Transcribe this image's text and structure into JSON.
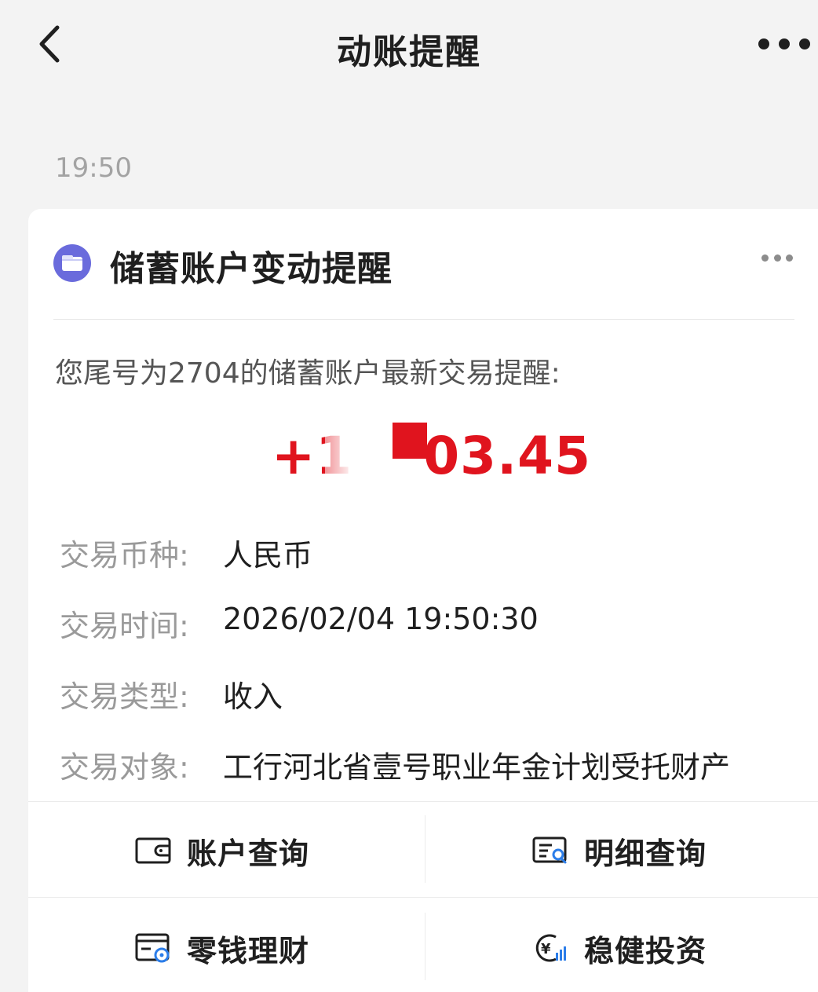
{
  "header": {
    "title": "动账提醒",
    "back_icon": "chevron-left-icon",
    "more_icon": "more-horizontal-icon"
  },
  "message": {
    "time": "19:50"
  },
  "card": {
    "icon": "wallet-icon",
    "icon_color": "#6a6bdc",
    "title": "储蓄账户变动提醒",
    "more_icon": "more-horizontal-icon",
    "intro": "您尾号为2704的储蓄账户最新交易提醒:",
    "amount": {
      "visible_prefix": "+1",
      "visible_suffix": "03.45",
      "color": "#e0141e"
    },
    "details": [
      {
        "label": "交易币种:",
        "value": "人民币"
      },
      {
        "label": "交易时间:",
        "value": "2026/02/04 19:50:30"
      },
      {
        "label": "交易类型:",
        "value": "收入"
      },
      {
        "label": "交易对象:",
        "value": "工行河北省壹号职业年金计划受托财产"
      }
    ]
  },
  "actions": [
    {
      "label": "账户查询",
      "icon": "wallet-card-icon"
    },
    {
      "label": "明细查询",
      "icon": "list-search-icon"
    },
    {
      "label": "零钱理财",
      "icon": "card-coin-icon"
    },
    {
      "label": "稳健投资",
      "icon": "yen-chart-icon"
    }
  ]
}
